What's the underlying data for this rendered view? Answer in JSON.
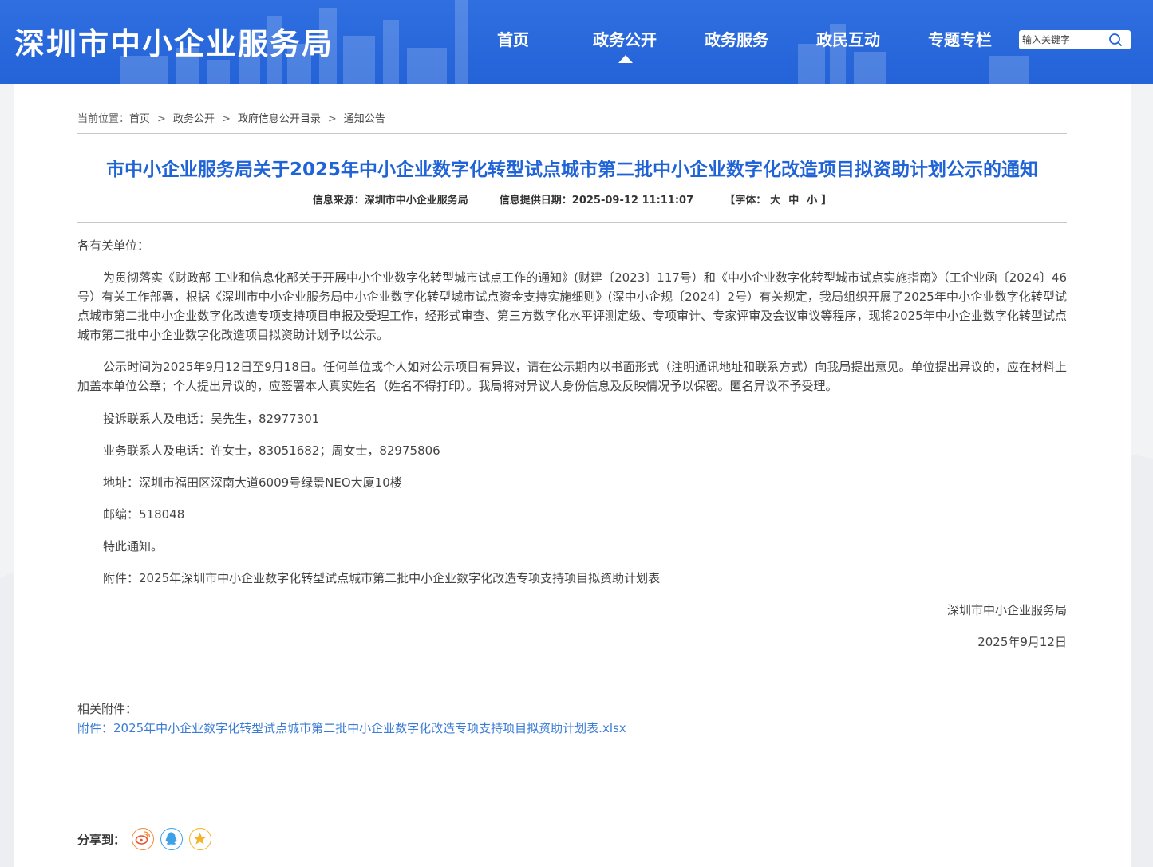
{
  "header": {
    "site_title": "深圳市中小企业服务局",
    "nav": [
      {
        "label": "首页"
      },
      {
        "label": "政务公开",
        "active": true
      },
      {
        "label": "政务服务"
      },
      {
        "label": "政民互动"
      },
      {
        "label": "专题专栏"
      }
    ],
    "search": {
      "placeholder": "输入关键字"
    }
  },
  "breadcrumb": {
    "prefix": "当前位置：",
    "items": [
      "首页",
      "政务公开",
      "政府信息公开目录",
      "通知公告"
    ],
    "separator": ">"
  },
  "article": {
    "title": "市中小企业服务局关于2025年中小企业数字化转型试点城市第二批中小企业数字化改造项目拟资助计划公示的通知",
    "meta": {
      "source_label": "信息来源：",
      "source": "深圳市中小企业服务局",
      "date_label": "信息提供日期：",
      "date": "2025-09-12 11:11:07",
      "font_label": "【字体：",
      "font_sizes": [
        "大",
        "中",
        "小"
      ],
      "font_close": "】"
    },
    "salutation": "各有关单位：",
    "paragraphs": [
      "为贯彻落实《财政部 工业和信息化部关于开展中小企业数字化转型城市试点工作的通知》(财建〔2023〕117号）和《中小企业数字化转型城市试点实施指南》（工企业函〔2024〕46号）有关工作部署，根据《深圳市中小企业服务局中小企业数字化转型城市试点资金支持实施细则》(深中小企规〔2024〕2号）有关规定，我局组织开展了2025年中小企业数字化转型试点城市第二批中小企业数字化改造专项支持项目申报及受理工作，经形式审查、第三方数字化水平评测定级、专项审计、专家评审及会议审议等程序，现将2025年中小企业数字化转型试点城市第二批中小企业数字化改造项目拟资助计划予以公示。",
      "公示时间为2025年9月12日至9月18日。任何单位或个人如对公示项目有异议，请在公示期内以书面形式（注明通讯地址和联系方式）向我局提出意见。单位提出异议的，应在材料上加盖本单位公章；个人提出异议的，应签署本人真实姓名（姓名不得打印）。我局将对异议人身份信息及反映情况予以保密。匿名异议不予受理。"
    ],
    "lines": [
      "投诉联系人及电话：吴先生，82977301",
      "业务联系人及电话：许女士，83051682；周女士，82975806",
      "地址：深圳市福田区深南大道6009号绿景NEO大厦10楼",
      "邮编：518048",
      "特此通知。",
      "附件：2025年深圳市中小企业数字化转型试点城市第二批中小企业数字化改造专项支持项目拟资助计划表"
    ],
    "signature": "深圳市中小企业服务局",
    "sign_date": "2025年9月12日"
  },
  "attachments": {
    "label": "相关附件：",
    "link": "附件：2025年中小企业数字化转型试点城市第二批中小企业数字化改造专项支持项目拟资助计划表.xlsx"
  },
  "share": {
    "label": "分享到：",
    "buttons": [
      {
        "icon": "weibo-icon",
        "color": "#f28b3c"
      },
      {
        "icon": "qq-icon",
        "color": "#3ea1e8"
      },
      {
        "icon": "qzone-icon",
        "color": "#f5b327"
      }
    ]
  }
}
